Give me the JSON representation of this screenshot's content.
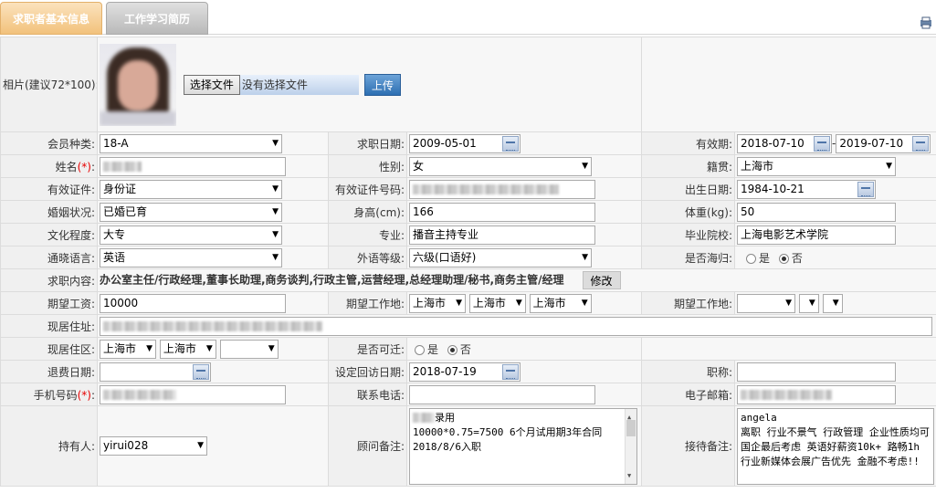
{
  "tabs": {
    "active": "求职者基本信息",
    "inactive": "工作学习简历"
  },
  "photo": {
    "label": "相片(建议72*100):",
    "choose_button": "选择文件",
    "no_file": "没有选择文件",
    "upload_button": "上传"
  },
  "member_type": {
    "label": "会员种类:",
    "value": "18-A"
  },
  "job_date": {
    "label": "求职日期:",
    "value": "2009-05-01"
  },
  "validity": {
    "label": "有效期:",
    "from": "2018-07-10",
    "sep": "-",
    "to": "2019-07-10"
  },
  "name": {
    "label": "姓名",
    "req": "(*)",
    "colon": ":"
  },
  "gender": {
    "label": "性别:",
    "value": "女"
  },
  "hometown": {
    "label": "籍贯:",
    "value": "上海市"
  },
  "id_type": {
    "label": "有效证件:",
    "value": "身份证"
  },
  "id_number": {
    "label": "有效证件号码:"
  },
  "birth": {
    "label": "出生日期:",
    "value": "1984-10-21"
  },
  "marital": {
    "label": "婚姻状况:",
    "value": "已婚已育"
  },
  "height": {
    "label": "身高(cm):",
    "value": "166"
  },
  "weight": {
    "label": "体重(kg):",
    "value": "50"
  },
  "education": {
    "label": "文化程度:",
    "value": "大专"
  },
  "major": {
    "label": "专业:",
    "value": "播音主持专业"
  },
  "school": {
    "label": "毕业院校:",
    "value": "上海电影艺术学院"
  },
  "language": {
    "label": "通晓语言:",
    "value": "英语"
  },
  "lang_level": {
    "label": "外语等级:",
    "value": "六级(口语好)"
  },
  "overseas": {
    "label": "是否海归:",
    "yes": "是",
    "no": "否"
  },
  "job_content": {
    "label": "求职内容:",
    "value": "办公室主任/行政经理,董事长助理,商务谈判,行政主管,运营经理,总经理助理/秘书,商务主管/经理",
    "modify": "修改"
  },
  "salary": {
    "label": "期望工资:",
    "value": "10000"
  },
  "work_loc1": {
    "label": "期望工作地:",
    "a": "上海市",
    "b": "上海市",
    "c": "上海市"
  },
  "work_loc2": {
    "label": "期望工作地:"
  },
  "address": {
    "label": "现居住址:"
  },
  "area": {
    "label": "现居住区:",
    "a": "上海市",
    "b": "上海市"
  },
  "relocate": {
    "label": "是否可迁:",
    "yes": "是",
    "no": "否"
  },
  "refund_date": {
    "label": "退费日期:"
  },
  "visit_date": {
    "label": "设定回访日期:",
    "value": "2018-07-19"
  },
  "title": {
    "label": "职称:"
  },
  "mobile": {
    "label": "手机号码",
    "req": "(*)",
    "colon": ":"
  },
  "phone": {
    "label": "联系电话:"
  },
  "email": {
    "label": "电子邮箱:"
  },
  "holder": {
    "label": "持有人:",
    "value": "yirui028"
  },
  "consultant_note": {
    "label": "顾问备注:",
    "line1": "录用",
    "line2": "10000*0.75=7500 6个月试用期3年合同",
    "line3": "2018/8/6入职"
  },
  "reception_note": {
    "label": "接待备注:",
    "line1": "angela",
    "line2": "离职 行业不景气 行政管理 企业性质均可国企最后考虑 英语好薪资10k+ 路畅1h 行业新媒体会展广告优先 金融不考虑!!"
  },
  "icons": {
    "print": "print-icon",
    "calendar": "calendar-icon",
    "dropdown": "chevron-down-icon"
  }
}
